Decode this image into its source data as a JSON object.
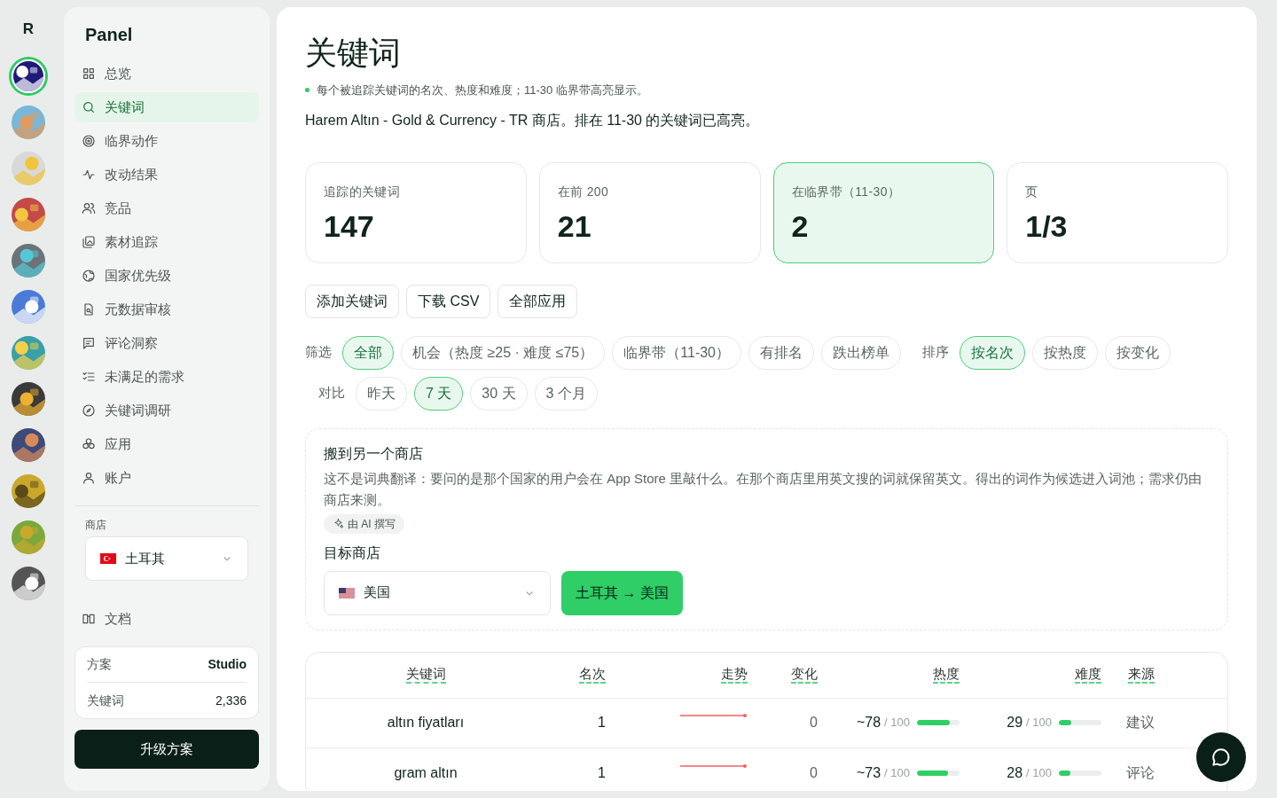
{
  "rail": {
    "logo": "R",
    "apps": [
      {
        "selected": true
      },
      {
        "selected": false
      },
      {
        "selected": false
      },
      {
        "selected": false
      },
      {
        "selected": false
      },
      {
        "selected": false
      },
      {
        "selected": false
      },
      {
        "selected": false
      },
      {
        "selected": false
      },
      {
        "selected": false
      },
      {
        "selected": false
      },
      {
        "selected": false
      }
    ]
  },
  "sidebar": {
    "title": "Panel",
    "items": [
      {
        "label": "总览",
        "selected": false
      },
      {
        "label": "关键词",
        "selected": true
      },
      {
        "label": "临界动作",
        "selected": false
      },
      {
        "label": "改动结果",
        "selected": false
      },
      {
        "label": "竞品",
        "selected": false
      },
      {
        "label": "素材追踪",
        "selected": false
      },
      {
        "label": "国家优先级",
        "selected": false
      },
      {
        "label": "元数据审核",
        "selected": false
      },
      {
        "label": "评论洞察",
        "selected": false
      },
      {
        "label": "未满足的需求",
        "selected": false
      },
      {
        "label": "关键词调研",
        "selected": false
      },
      {
        "label": "应用",
        "selected": false
      },
      {
        "label": "账户",
        "selected": false
      }
    ],
    "store_label": "商店",
    "store": {
      "value": "土耳其"
    },
    "docs": "文档",
    "plan": [
      {
        "label": "方案",
        "value": "Studio"
      },
      {
        "label": "关键词",
        "value": "2,336"
      }
    ],
    "upgrade": "升级方案"
  },
  "main": {
    "title": "关键词",
    "subtitle": "每个被追踪关键词的名次、热度和难度；11-30 临界带高亮显示。",
    "description": "Harem Altın - Gold & Currency - TR 商店。排在 11-30 的关键词已高亮。",
    "stats": [
      {
        "label": "追踪的关键词",
        "value": "147",
        "selected": false
      },
      {
        "label": "在前 200",
        "value": "21",
        "selected": false
      },
      {
        "label": "在临界带（11-30）",
        "value": "2",
        "selected": true
      },
      {
        "label": "页",
        "value": "1/3",
        "selected": false
      }
    ],
    "actions": [
      "添加关键词",
      "下载 CSV",
      "全部应用"
    ],
    "filter_label": "筛选",
    "filters": [
      {
        "label": "全部",
        "selected": true
      },
      {
        "label": "机会（热度 ≥25 · 难度 ≤75）",
        "selected": false
      },
      {
        "label": "临界带（11-30）",
        "selected": false
      },
      {
        "label": "有排名",
        "selected": false
      },
      {
        "label": "跌出榜单",
        "selected": false
      }
    ],
    "sort_label": "排序",
    "sorts": [
      {
        "label": "按名次",
        "selected": true
      },
      {
        "label": "按热度",
        "selected": false
      },
      {
        "label": "按变化",
        "selected": false
      }
    ],
    "compare_label": "对比",
    "compares": [
      {
        "label": "昨天",
        "selected": false
      },
      {
        "label": "7 天",
        "selected": true
      },
      {
        "label": "30 天",
        "selected": false
      },
      {
        "label": "3 个月",
        "selected": false
      }
    ],
    "move": {
      "title": "搬到另一个商店",
      "text": "这不是词典翻译：要问的是那个国家的用户会在 App Store 里敲什么。在那个商店里用英文搜的词就保留英文。得出的词作为候选进入词池；需求仍由商店来测。",
      "ai_badge": "由 AI 撰写",
      "target_label": "目标商店",
      "target": {
        "value": "美国"
      },
      "button": "土耳其 → 美国"
    },
    "table": {
      "columns": [
        "关键词",
        "名次",
        "走势",
        "变化",
        "热度",
        "难度",
        "来源"
      ],
      "rows": [
        {
          "keyword": "altın fiyatları",
          "rank": "1",
          "change": "0",
          "heat": "~78",
          "heat_max": "/ 100",
          "heat_meter": {
            "level": 0.78
          },
          "difficulty": "29",
          "difficulty_max": "/ 100",
          "difficulty_meter": {
            "level": 0.29
          },
          "source": "建议"
        },
        {
          "keyword": "gram altın",
          "rank": "1",
          "change": "0",
          "heat": "~73",
          "heat_max": "/ 100",
          "heat_meter": {
            "level": 0.73
          },
          "difficulty": "28",
          "difficulty_max": "/ 100",
          "difficulty_meter": {
            "level": 0.28
          },
          "source": "评论"
        }
      ]
    }
  }
}
